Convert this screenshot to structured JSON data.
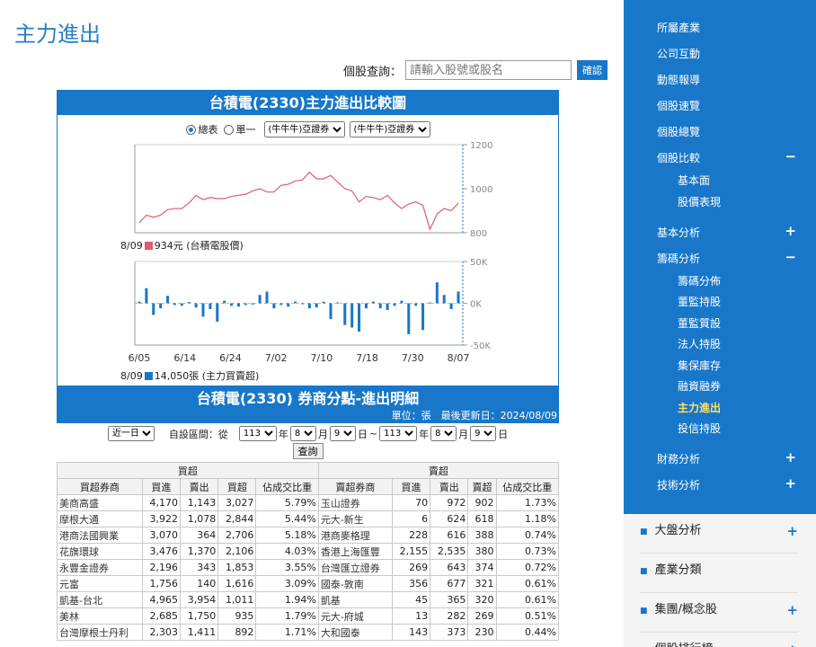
{
  "page_title": "主力進出",
  "search": {
    "label": "個股查詢：",
    "placeholder": "請輸入股號或股名",
    "button": "確認"
  },
  "chart_panel": {
    "title": "台積電(2330)主力進出比較圖",
    "radio1": "總表",
    "radio2": "單一",
    "select1": "(牛牛牛)亞證券",
    "select2": "(牛牛牛)亞證券",
    "legend1_date": "8/09",
    "legend1_text": "934元 (台積電股價)",
    "legend1_color": "#e05a6e",
    "legend2_date": "8/09",
    "legend2_text": "14,050張 (主力買賣超)",
    "legend2_color": "#1877c9"
  },
  "chart_data": [
    {
      "type": "line",
      "title": "",
      "ylim": [
        800,
        1200
      ],
      "yticks": [
        "1200",
        "1000",
        "800"
      ],
      "x": [
        "6/05",
        "6/06",
        "6/07",
        "6/11",
        "6/12",
        "6/13",
        "6/14",
        "6/17",
        "6/18",
        "6/19",
        "6/20",
        "6/21",
        "6/24",
        "6/25",
        "6/26",
        "6/27",
        "6/28",
        "7/01",
        "7/02",
        "7/03",
        "7/04",
        "7/05",
        "7/08",
        "7/09",
        "7/10",
        "7/11",
        "7/12",
        "7/15",
        "7/16",
        "7/17",
        "7/18",
        "7/19",
        "7/22",
        "7/23",
        "7/24",
        "7/26",
        "7/29",
        "7/30",
        "7/31",
        "8/01",
        "8/02",
        "8/05",
        "8/06",
        "8/07",
        "8/08",
        "8/09"
      ],
      "series": [
        {
          "values": [
            845,
            880,
            870,
            880,
            905,
            910,
            910,
            935,
            970,
            950,
            960,
            955,
            955,
            965,
            970,
            975,
            990,
            1000,
            985,
            985,
            1015,
            1020,
            1035,
            1040,
            1075,
            1045,
            1045,
            1060,
            1030,
            1000,
            990,
            940,
            965,
            960,
            950,
            970,
            935,
            910,
            930,
            940,
            925,
            815,
            885,
            910,
            900,
            934
          ]
        }
      ]
    },
    {
      "type": "bar",
      "title": "",
      "ylim": [
        -50000,
        50000
      ],
      "yticks": [
        "50K",
        "0K",
        "-50K"
      ],
      "xticks": [
        "6/05",
        "6/14",
        "6/24",
        "7/02",
        "7/10",
        "7/18",
        "7/30",
        "8/07"
      ],
      "series": [
        {
          "values": [
            2000,
            18000,
            -14000,
            -6000,
            9000,
            -2000,
            -3000,
            1500,
            -5000,
            -16000,
            -7000,
            -22000,
            3000,
            -3000,
            -4000,
            -2000,
            -1500,
            10000,
            14000,
            -6000,
            -2000,
            -4000,
            2000,
            -1000,
            -6000,
            -5000,
            2000,
            -19000,
            1000,
            -26000,
            -29000,
            -34000,
            -6000,
            2000,
            -6000,
            -8000,
            -3000,
            3000,
            -37000,
            -3000,
            -32000,
            1000,
            25000,
            10000,
            -7000,
            14050
          ]
        }
      ]
    }
  ],
  "broker_panel": {
    "title": "台積電(2330) 券商分點-進出明細",
    "unit": "單位：張　最後更新日：2024/08/09",
    "period": "近一日",
    "custom_label": "自設區間：從",
    "y1": "113",
    "m1": "8",
    "d1": "9",
    "y2": "113",
    "m2": "8",
    "d2": "9",
    "nian": "年",
    "yue": "月",
    "ri": "日",
    "tilde": "~",
    "query": "查詢",
    "buy_header": "買超",
    "sell_header": "賣超",
    "cols": [
      "買超券商",
      "買進",
      "賣出",
      "買超",
      "佔成交比重",
      "賣超券商",
      "買進",
      "賣出",
      "賣超",
      "佔成交比重"
    ],
    "rows": [
      [
        "美商高盛",
        "4,170",
        "1,143",
        "3,027",
        "5.79%",
        "玉山證券",
        "70",
        "972",
        "902",
        "1.73%"
      ],
      [
        "摩根大通",
        "3,922",
        "1,078",
        "2,844",
        "5.44%",
        "元大-新生",
        "6",
        "624",
        "618",
        "1.18%"
      ],
      [
        "港商法國興業",
        "3,070",
        "364",
        "2,706",
        "5.18%",
        "港商麥格理",
        "228",
        "616",
        "388",
        "0.74%"
      ],
      [
        "花旗環球",
        "3,476",
        "1,370",
        "2,106",
        "4.03%",
        "香港上海匯豐",
        "2,155",
        "2,535",
        "380",
        "0.73%"
      ],
      [
        "永豐金證券",
        "2,196",
        "343",
        "1,853",
        "3.55%",
        "台灣匯立證券",
        "269",
        "643",
        "374",
        "0.72%"
      ],
      [
        "元富",
        "1,756",
        "140",
        "1,616",
        "3.09%",
        "國泰-敦南",
        "356",
        "677",
        "321",
        "0.61%"
      ],
      [
        "凱基-台北",
        "4,965",
        "3,954",
        "1,011",
        "1.94%",
        "凱基",
        "45",
        "365",
        "320",
        "0.61%"
      ],
      [
        "美林",
        "2,685",
        "1,750",
        "935",
        "1.79%",
        "元大-府城",
        "13",
        "282",
        "269",
        "0.51%"
      ],
      [
        "台灣摩根士丹利",
        "2,303",
        "1,411",
        "892",
        "1.71%",
        "大和國泰",
        "143",
        "373",
        "230",
        "0.44%"
      ]
    ]
  },
  "sidebar": {
    "items": [
      {
        "label": "所屬產業"
      },
      {
        "label": "公司互動"
      },
      {
        "label": "動態報導"
      },
      {
        "label": "個股速覽"
      },
      {
        "label": "個股總覽"
      },
      {
        "label": "個股比較",
        "sign": "−"
      },
      {
        "label": "基本面",
        "sub": true
      },
      {
        "label": "股價表現",
        "sub": true
      },
      {
        "label": "基本分析",
        "sign": "+"
      },
      {
        "label": "籌碼分析",
        "sign": "−"
      },
      {
        "label": "籌碼分佈",
        "sub": true
      },
      {
        "label": "董監持股",
        "sub": true
      },
      {
        "label": "董監質設",
        "sub": true
      },
      {
        "label": "法人持股",
        "sub": true
      },
      {
        "label": "集保庫存",
        "sub": true
      },
      {
        "label": "融資融券",
        "sub": true
      },
      {
        "label": "主力進出",
        "sub": true,
        "active": true
      },
      {
        "label": "投信持股",
        "sub": true
      },
      {
        "label": "財務分析",
        "sign": "+"
      },
      {
        "label": "技術分析",
        "sign": "+"
      }
    ],
    "sections": [
      {
        "label": "大盤分析",
        "sign": "+"
      },
      {
        "label": "產業分類",
        "sign": ""
      },
      {
        "label": "集團/概念股",
        "sign": "+"
      },
      {
        "label": "個股排行榜",
        "sign": "+"
      }
    ]
  }
}
